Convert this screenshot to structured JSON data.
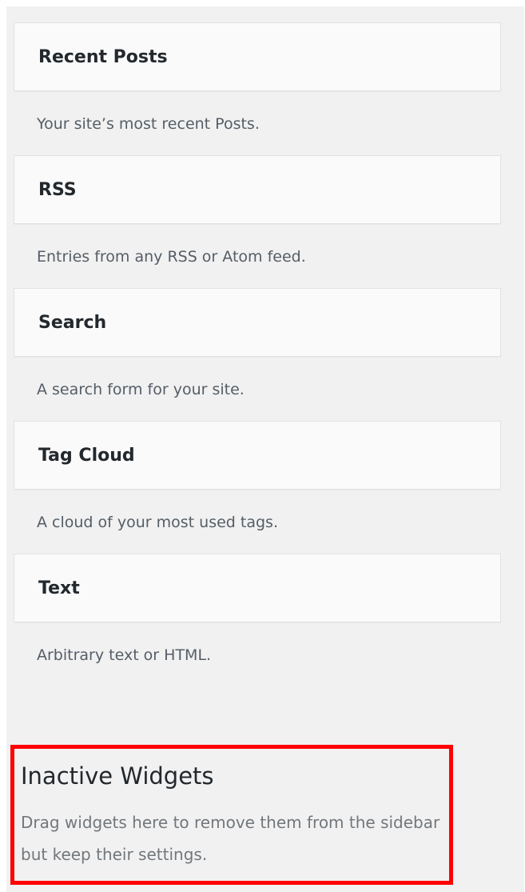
{
  "available_widgets": {
    "items": [
      {
        "title": "Recent Posts",
        "description": "Your site’s most recent Posts."
      },
      {
        "title": "RSS",
        "description": "Entries from any RSS or Atom feed."
      },
      {
        "title": "Search",
        "description": "A search form for your site."
      },
      {
        "title": "Tag Cloud",
        "description": "A cloud of your most used tags."
      },
      {
        "title": "Text",
        "description": "Arbitrary text or HTML."
      }
    ]
  },
  "inactive_widgets": {
    "title": "Inactive Widgets",
    "description": "Drag widgets here to remove them from the sidebar but keep their settings."
  },
  "colors": {
    "panel_background": "#f1f1f1",
    "widget_background": "#fafafa",
    "highlight_border": "#ff0000"
  }
}
